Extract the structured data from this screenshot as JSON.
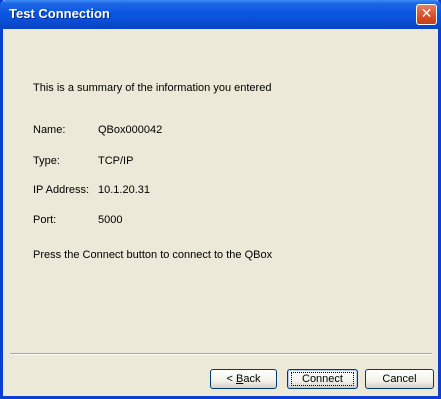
{
  "window": {
    "title": "Test Connection"
  },
  "summary": {
    "intro": "This is a summary of the information you entered",
    "fields": [
      {
        "label": "Name:",
        "value": "QBox000042"
      },
      {
        "label": "Type:",
        "value": "TCP/IP"
      },
      {
        "label": "IP Address:",
        "value": "10.1.20.31"
      },
      {
        "label": "Port:",
        "value": "5000"
      }
    ],
    "instruction": "Press the Connect button to connect to the QBox"
  },
  "buttons": {
    "back_prefix": "< ",
    "back_mnemonic": "B",
    "back_rest": "ack",
    "connect": "Connect",
    "cancel": "Cancel"
  },
  "colors": {
    "titlebar": "#0a57e3",
    "dialog_bg": "#ece9d8",
    "close_button": "#d9532d"
  },
  "icons": {
    "close": "close-icon"
  }
}
